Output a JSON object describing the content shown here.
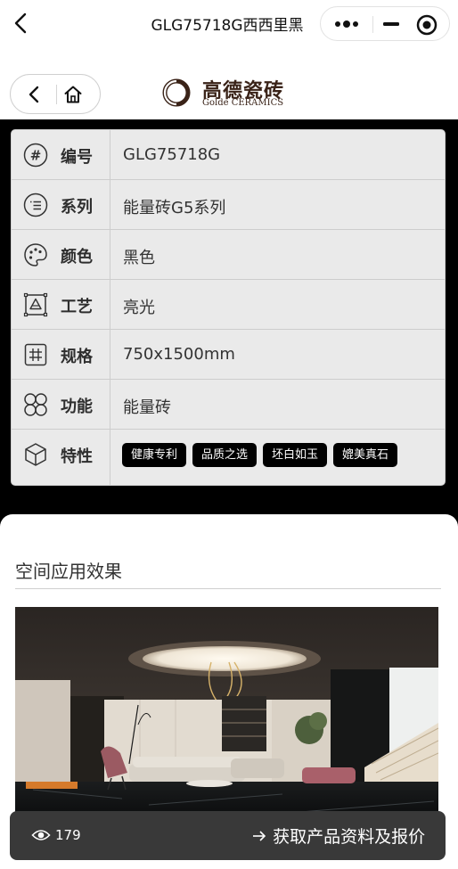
{
  "header": {
    "title": "GLG75718G西西里黑"
  },
  "brand": {
    "name_cn": "高德瓷砖",
    "name_en": "Golde CERAMICS"
  },
  "specs": [
    {
      "icon": "hash-icon",
      "label": "编号",
      "value": "GLG75718G"
    },
    {
      "icon": "list-icon",
      "label": "系列",
      "value": "能量砖G5系列"
    },
    {
      "icon": "palette-icon",
      "label": "颜色",
      "value": "黑色"
    },
    {
      "icon": "craft-icon",
      "label": "工艺",
      "value": "亮光"
    },
    {
      "icon": "grid-icon",
      "label": "规格",
      "value": "750x1500mm"
    },
    {
      "icon": "circles-icon",
      "label": "功能",
      "value": "能量砖"
    },
    {
      "icon": "cube-icon",
      "label": "特性",
      "tags": [
        "健康专利",
        "品质之选",
        "坯白如玉",
        "媲美真石"
      ]
    }
  ],
  "section": {
    "title": "空间应用效果"
  },
  "footer": {
    "views": "179",
    "cta_label": "获取产品资料及报价"
  },
  "colors": {
    "tag_bg": "#000000",
    "bar_bg": "#393939",
    "table_bg": "#eaeaea"
  }
}
